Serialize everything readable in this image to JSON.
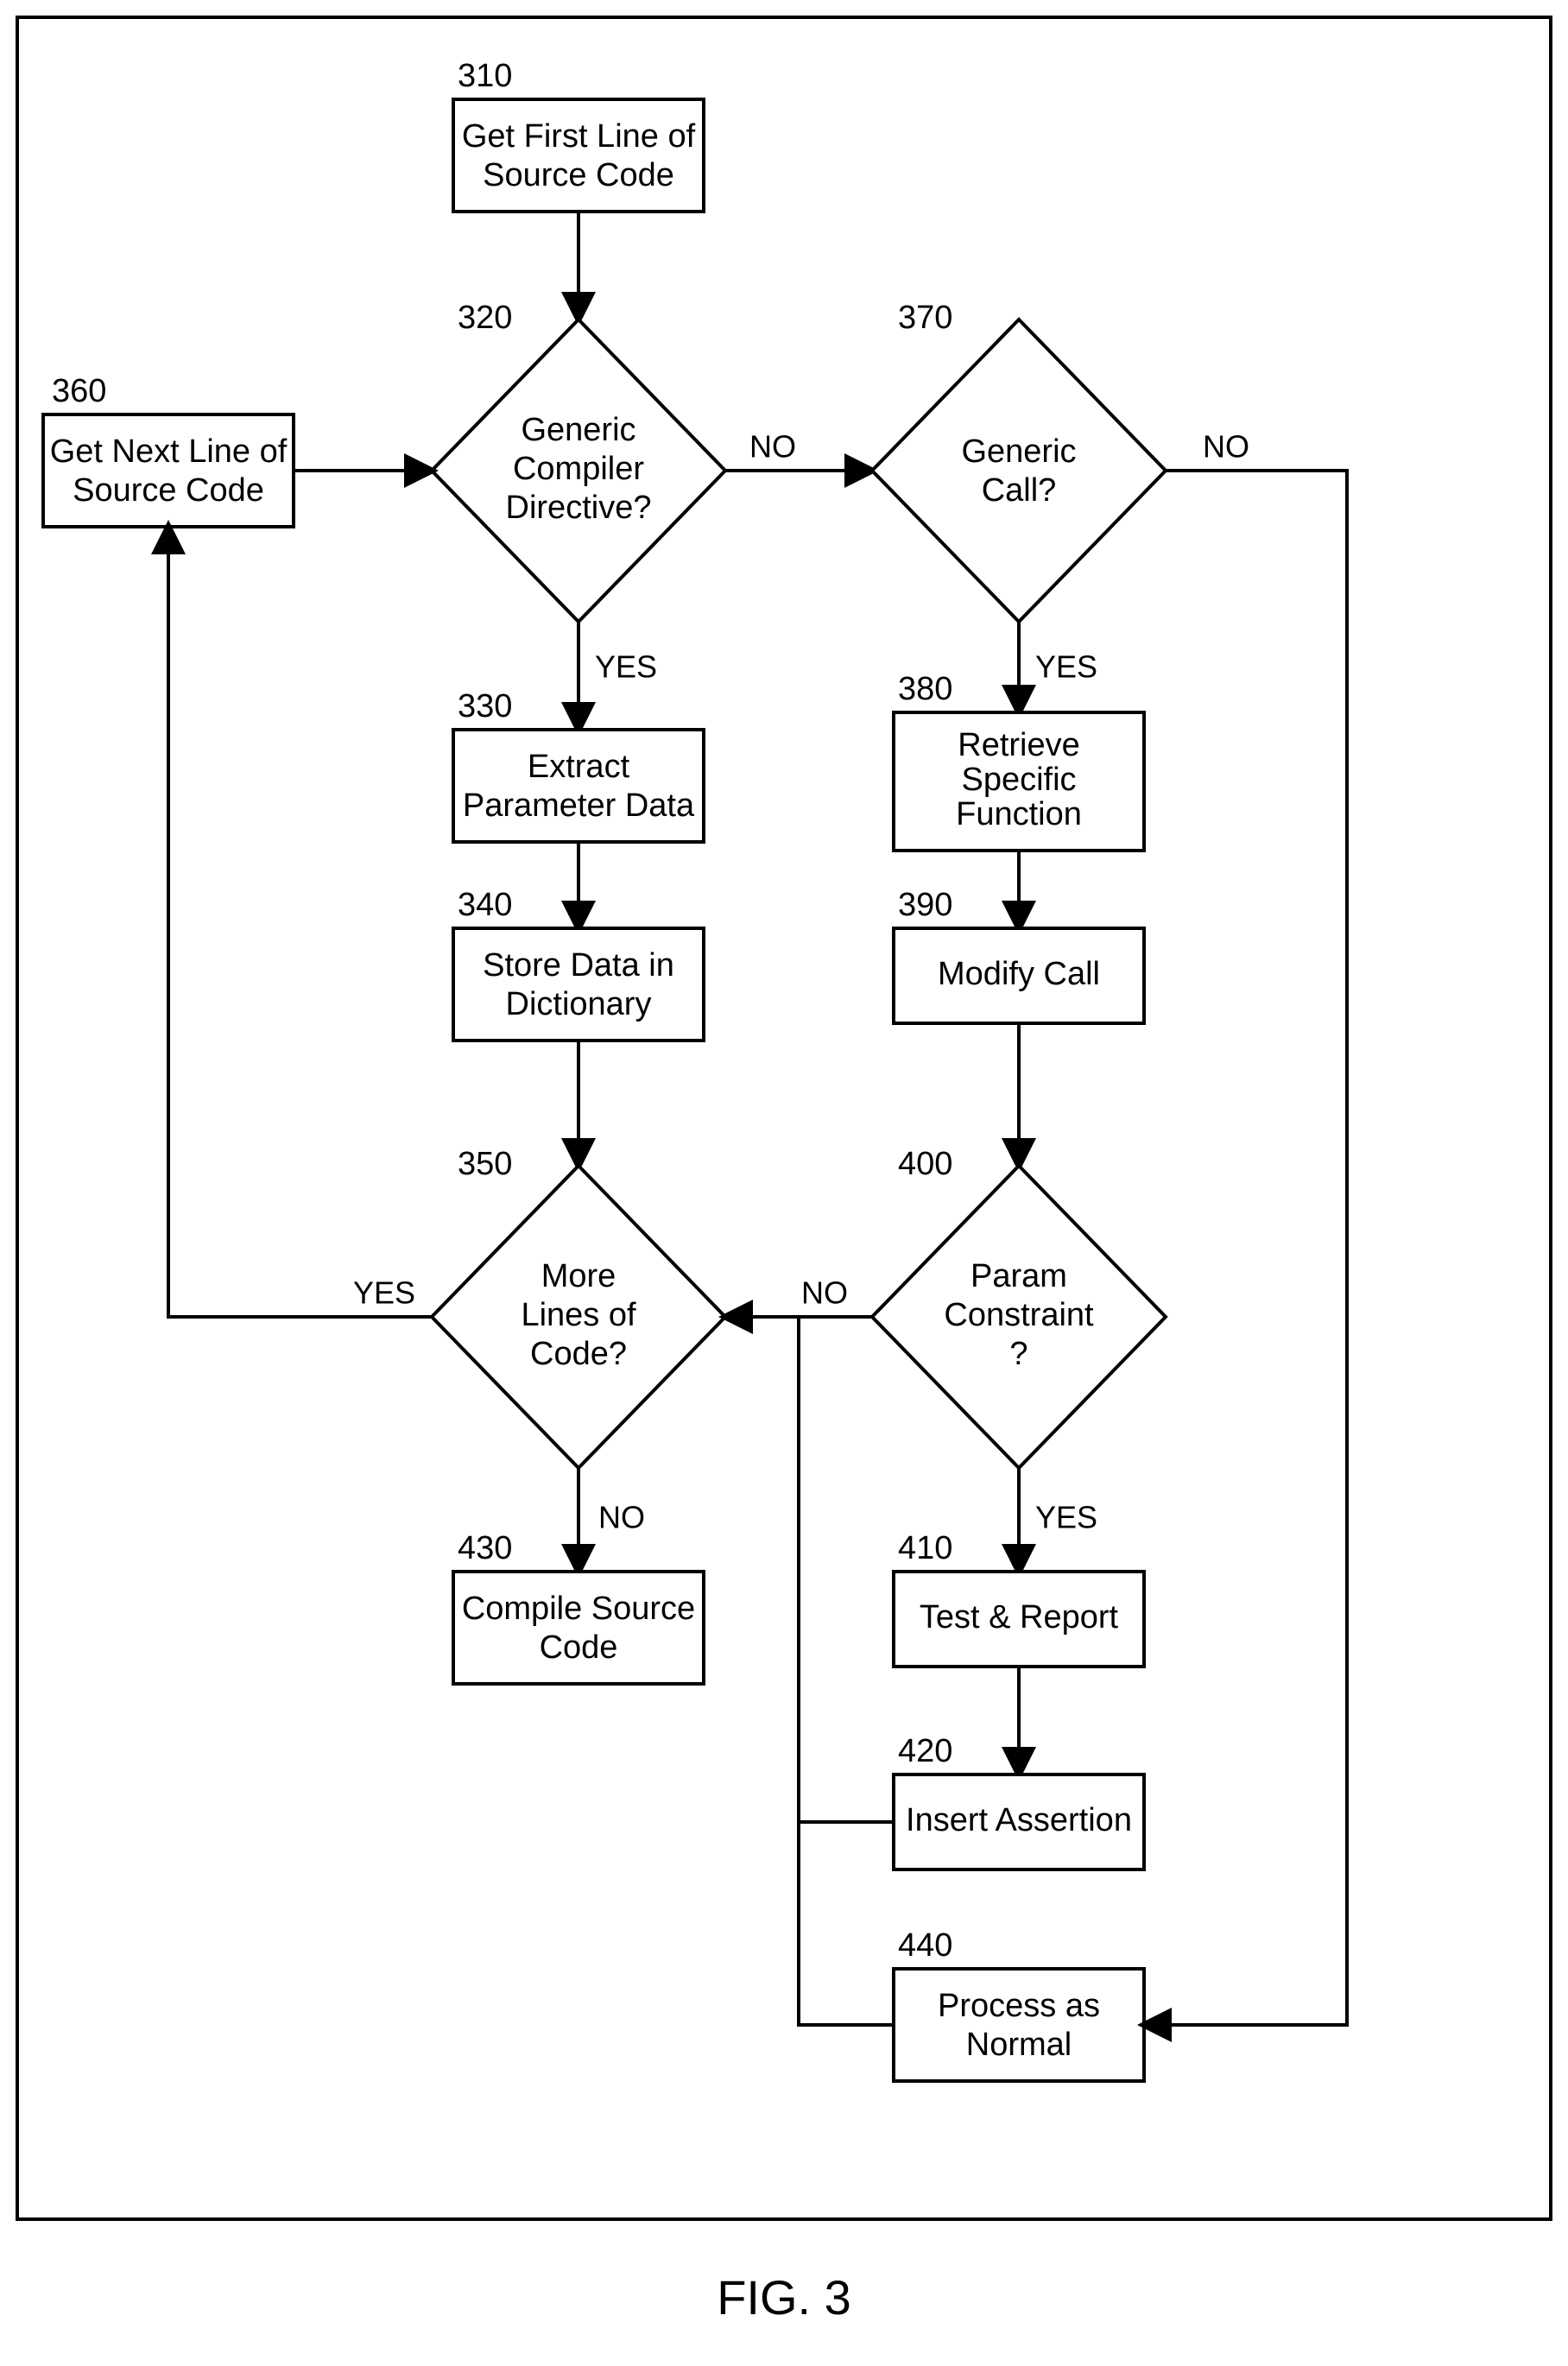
{
  "outer_box": true,
  "figure_caption": "FIG. 3",
  "nodes": {
    "n310": {
      "ref": "310",
      "line1": "Get First Line of",
      "line2": "Source Code"
    },
    "n320": {
      "ref": "320",
      "line1": "Generic",
      "line2": "Compiler",
      "line3": "Directive?"
    },
    "n330": {
      "ref": "330",
      "line1": "Extract",
      "line2": "Parameter Data"
    },
    "n340": {
      "ref": "340",
      "line1": "Store Data in",
      "line2": "Dictionary"
    },
    "n350": {
      "ref": "350",
      "line1": "More",
      "line2": "Lines of",
      "line3": "Code?"
    },
    "n360": {
      "ref": "360",
      "line1": "Get Next Line of",
      "line2": "Source Code"
    },
    "n370": {
      "ref": "370",
      "line1": "Generic",
      "line2": "Call?"
    },
    "n380": {
      "ref": "380",
      "line1": "Retrieve",
      "line2": "Specific",
      "line3": "Function"
    },
    "n390": {
      "ref": "390",
      "line1": "Modify Call"
    },
    "n400": {
      "ref": "400",
      "line1": "Param",
      "line2": "Constraint",
      "line3": "?"
    },
    "n410": {
      "ref": "410",
      "line1": "Test & Report"
    },
    "n420": {
      "ref": "420",
      "line1": "Insert Assertion"
    },
    "n430": {
      "ref": "430",
      "line1": "Compile Source",
      "line2": "Code"
    },
    "n440": {
      "ref": "440",
      "line1": "Process as",
      "line2": "Normal"
    }
  },
  "edge_labels": {
    "yes": "YES",
    "no": "NO"
  }
}
